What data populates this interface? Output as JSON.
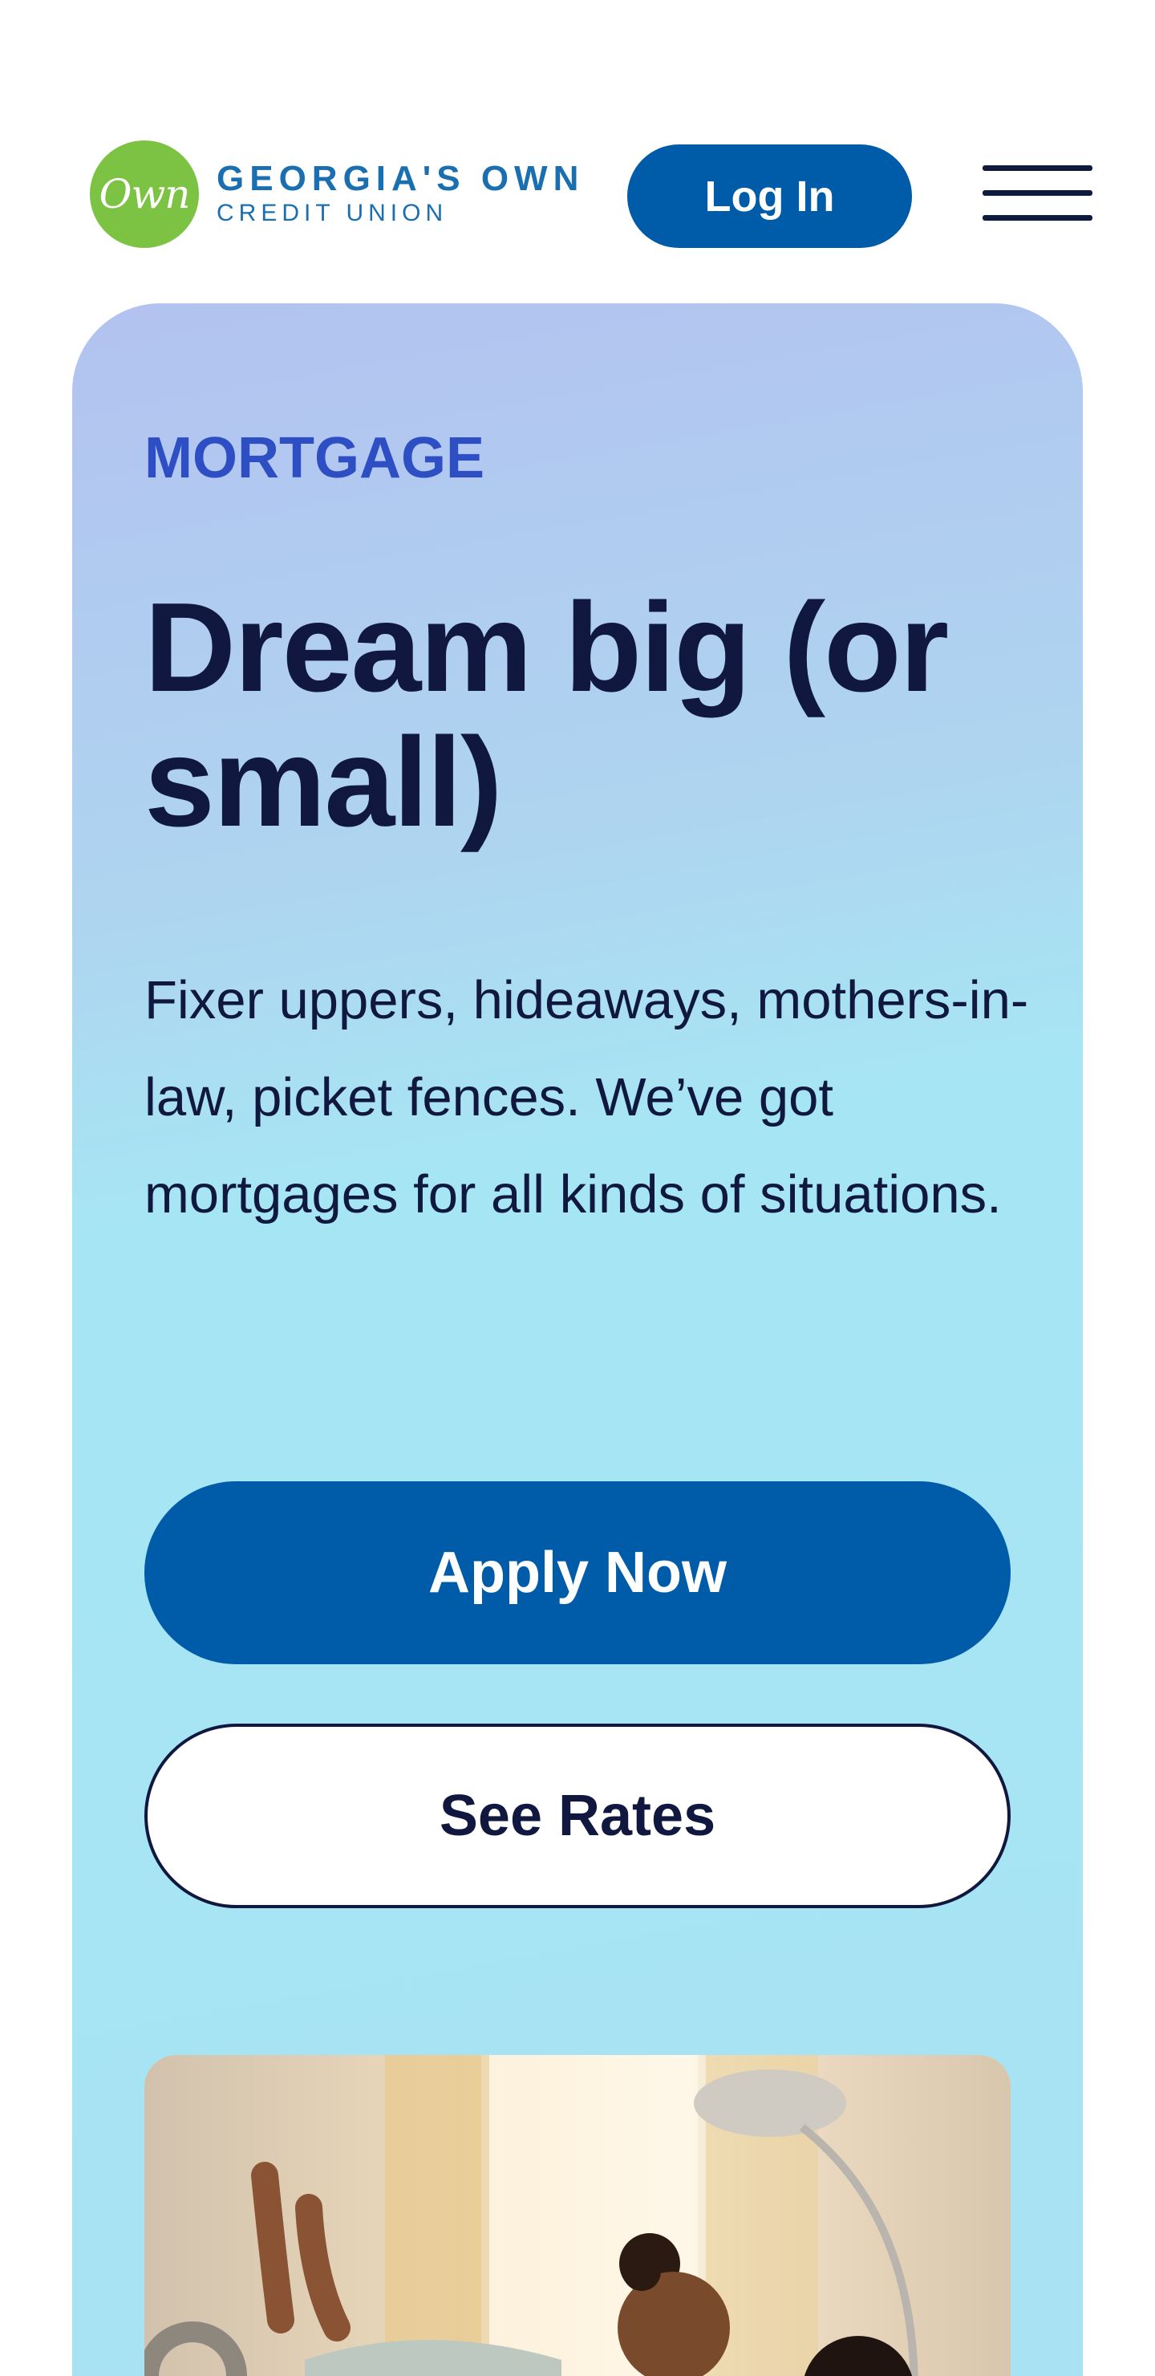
{
  "header": {
    "logo_mark": "Own",
    "logo_line1": "GEORGIA'S OWN",
    "logo_line2": "CREDIT UNION",
    "login_label": "Log In"
  },
  "hero": {
    "eyebrow": "MORTGAGE",
    "headline": "Dream big (or small)",
    "body": "Fixer uppers, hideaways, mothers-in-law, picket fences. We’ve got mortgages for all kinds of situations.",
    "primary_cta": "Apply Now",
    "secondary_cta": "See Rates"
  },
  "colors": {
    "brand_blue": "#005ca9",
    "logo_green": "#7cc243",
    "navy_text": "#10183f",
    "eyebrow_blue": "#2e4fc4"
  },
  "icons": {
    "menu": "hamburger-menu-icon"
  }
}
